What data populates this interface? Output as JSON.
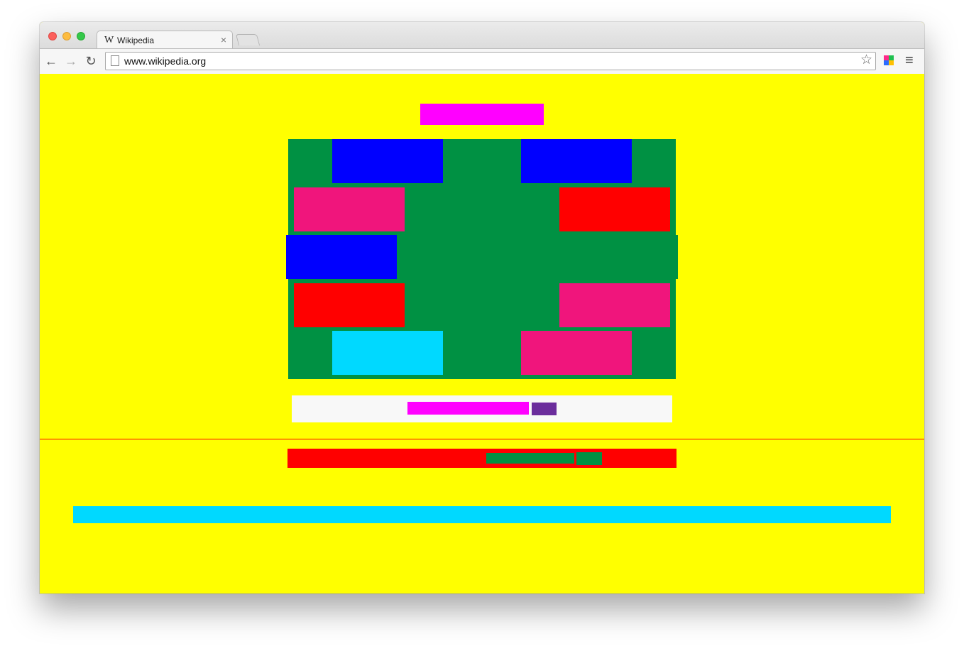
{
  "browser": {
    "tab_title": "Wikipedia",
    "tab_favicon": "W",
    "tab_close_label": "×",
    "url": "www.wikipedia.org",
    "icons": {
      "back": "arrow-left-icon",
      "forward": "arrow-right-icon",
      "reload": "reload-icon",
      "star": "star-icon",
      "menu": "hamburger-menu-icon"
    },
    "glyphs": {
      "back": "←",
      "forward": "→",
      "reload": "↻",
      "star": "☆",
      "menu": "≡"
    }
  },
  "colors": {
    "page_background": "#ffff00",
    "logo": "#ff00ff",
    "portal_background": "#009143",
    "blue": "#0000ff",
    "pink": "#f0157c",
    "red": "#ff0000",
    "cyan": "#00d9ff",
    "search_box": "#f8f8f8",
    "search_input": "#ff00ff",
    "search_button": "#6b2d9c",
    "divider": "#ff0000",
    "language_bar": "#ff0000",
    "language_select": "#009143",
    "language_button": "#009143",
    "footer_bar": "#00d9ff",
    "extension_icon": [
      "#ff2a8a",
      "#20c050",
      "#2a6cff",
      "#ffc000"
    ]
  }
}
